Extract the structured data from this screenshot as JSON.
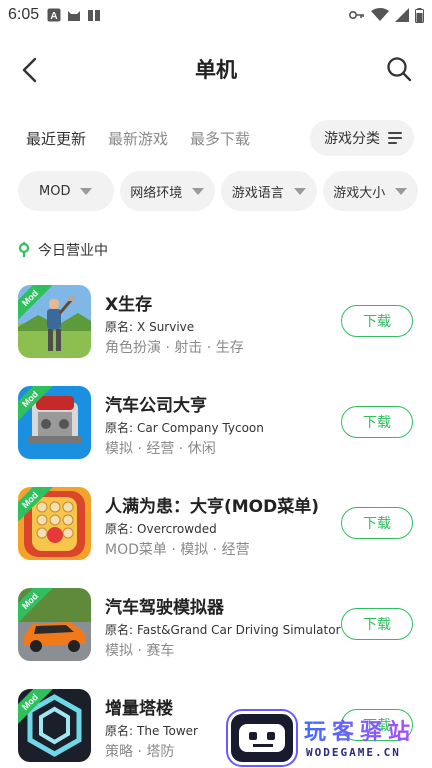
{
  "status_bar": {
    "time": "6:05",
    "left_icons": [
      "a-badge-icon",
      "cat-icon",
      "book-icon"
    ],
    "right_icons": [
      "key-icon",
      "wifi-icon",
      "signal-icon",
      "battery-icon"
    ]
  },
  "header": {
    "title": "单机",
    "back_icon": "chevron-left-icon",
    "search_icon": "search-icon"
  },
  "tabs": [
    {
      "label": "最近更新",
      "active": true
    },
    {
      "label": "最新游戏",
      "active": false
    },
    {
      "label": "最多下载",
      "active": false
    }
  ],
  "category_button": {
    "label": "游戏分类",
    "icon": "menu-lines-icon"
  },
  "filters": [
    {
      "label": "MOD"
    },
    {
      "label": "网络环境"
    },
    {
      "label": "游戏语言"
    },
    {
      "label": "游戏大小"
    }
  ],
  "section": {
    "title": "今日营业中",
    "icon": "location-pin-icon"
  },
  "games": [
    {
      "name": "X生存",
      "orig_label": "原名:",
      "orig_name": "X Survive",
      "tags": "角色扮演 · 射击 · 生存",
      "button": "下载",
      "mod_tag": "Mod",
      "icon": "survivor-icon"
    },
    {
      "name": "汽车公司大亨",
      "orig_label": "原名:",
      "orig_name": "Car Company Tycoon",
      "tags": "模拟 · 经营 · 休闲",
      "button": "下载",
      "mod_tag": "Mod",
      "icon": "engine-icon"
    },
    {
      "name": "人满为患：大亨(MOD菜单)",
      "orig_label": "原名:",
      "orig_name": "Overcrowded",
      "tags": "MOD菜单 · 模拟 · 经营",
      "button": "下载",
      "mod_tag": "Mod",
      "icon": "crowd-icon"
    },
    {
      "name": "汽车驾驶模拟器",
      "orig_label": "原名:",
      "orig_name": "Fast&Grand Car Driving Simulator",
      "tags": "模拟 · 赛车",
      "button": "下载",
      "mod_tag": "Mod",
      "icon": "sports-car-icon"
    },
    {
      "name": "增量塔楼",
      "orig_label": "原名:",
      "orig_name": "The Tower",
      "tags": "策略 · 塔防",
      "button": "下载",
      "mod_tag": "Mod",
      "icon": "hexagon-tower-icon"
    }
  ],
  "watermark": {
    "cn": "玩客驿站",
    "en": "WODEGAME.CN"
  },
  "colors": {
    "accent": "#2fbf5f",
    "tab_underline": "#9be3b6",
    "chip_bg": "#f2f2f2",
    "muted_text": "#8a8a8a"
  }
}
